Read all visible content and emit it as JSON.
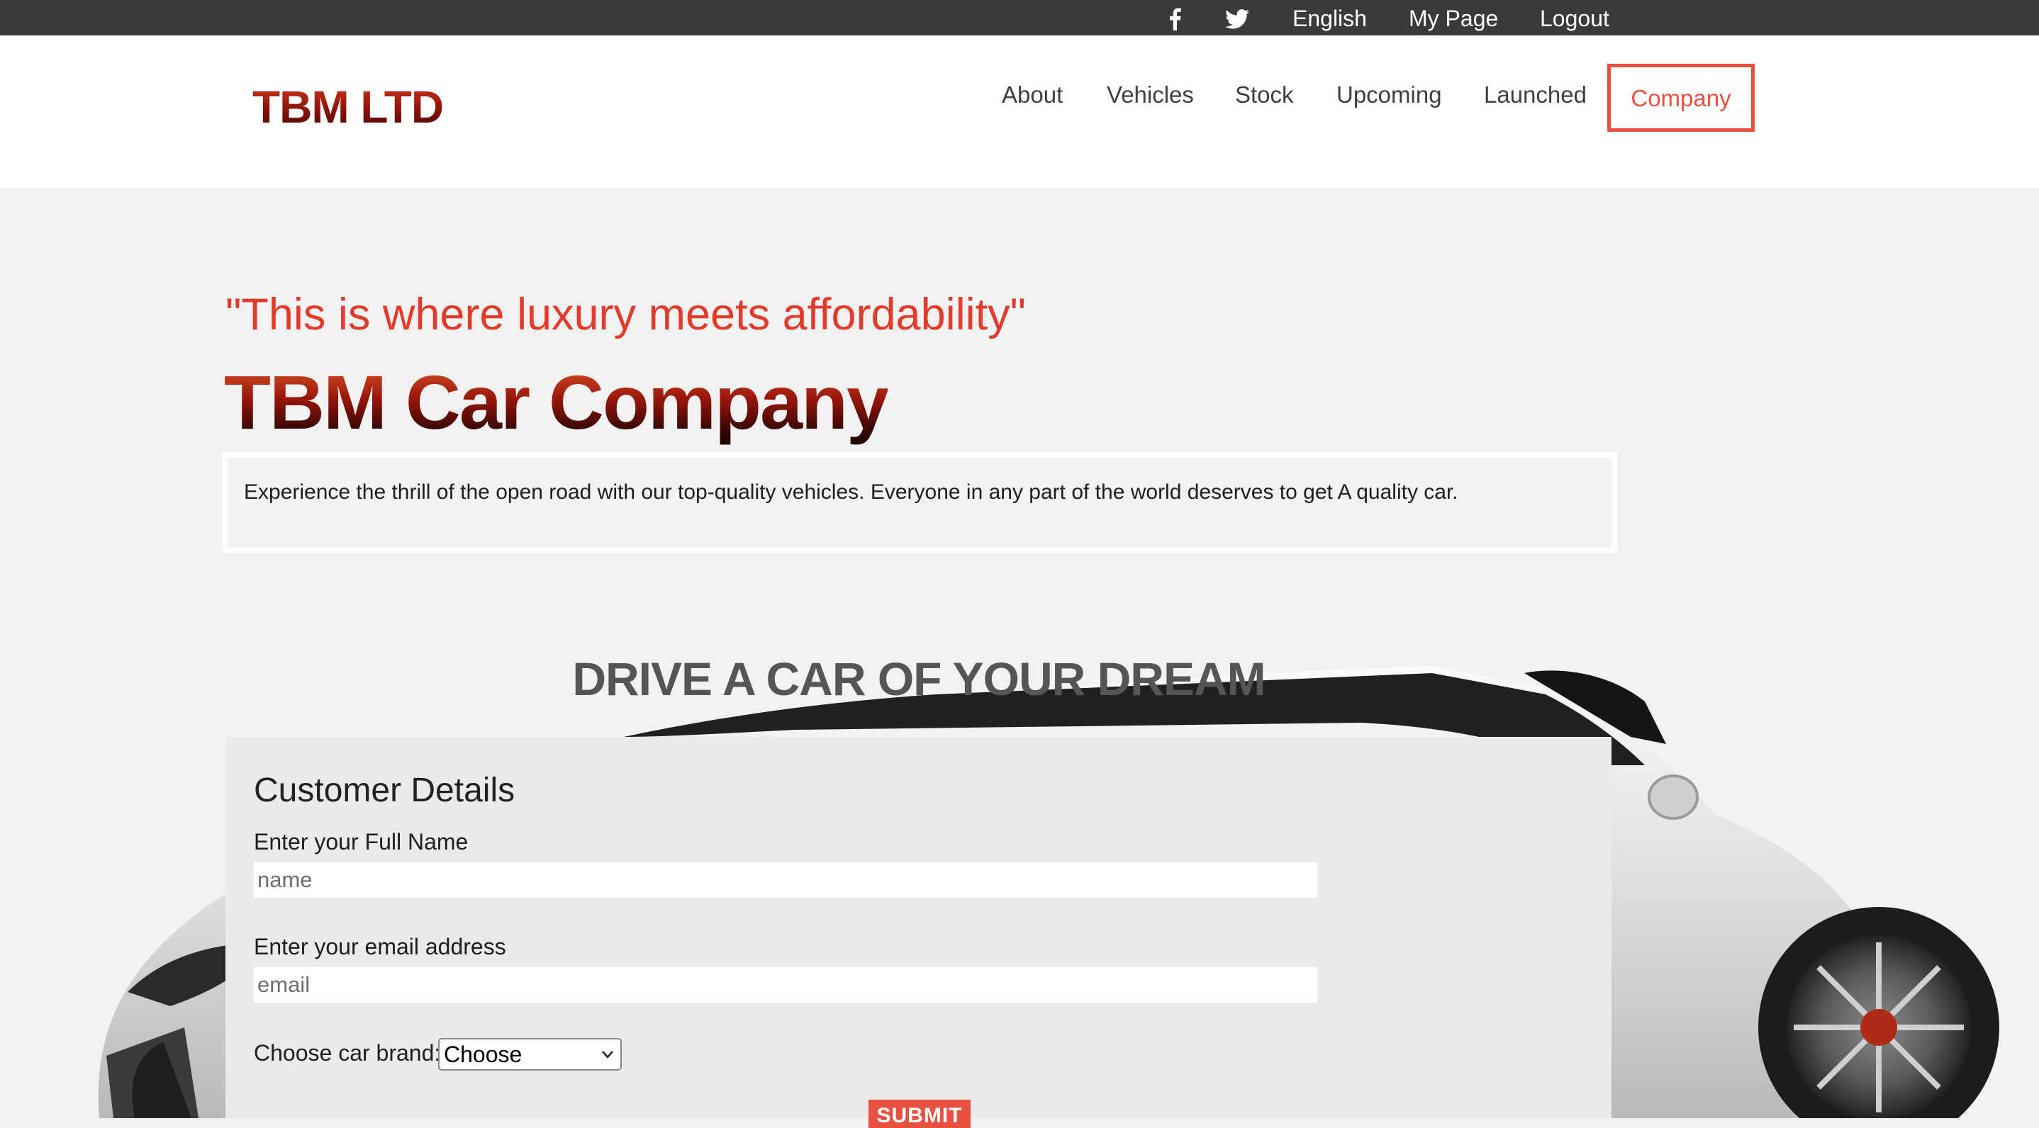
{
  "topbar": {
    "facebook_icon": "facebook-icon",
    "twitter_icon": "twitter-icon",
    "language": "English",
    "my_page": "My Page",
    "logout": "Logout"
  },
  "header": {
    "logo": "TBM LTD",
    "nav": {
      "about": "About",
      "vehicles": "Vehicles",
      "stock": "Stock",
      "upcoming": "Upcoming",
      "launched": "Launched",
      "company": "Company"
    }
  },
  "hero": {
    "tagline": "\"This is where luxury meets affordability\"",
    "title": "TBM Car Company",
    "description": "Experience the thrill of the open road with our top-quality vehicles. Everyone in any part of the world deserves to get A quality car."
  },
  "dream": {
    "heading": "DRIVE A CAR OF YOUR DREAM"
  },
  "form": {
    "title": "Customer Details",
    "name_label": "Enter your Full Name",
    "name_placeholder": "name",
    "email_label": "Enter your email address",
    "email_placeholder": "email",
    "brand_label": "Choose car brand:",
    "brand_selected": "Choose",
    "submit_label": "SUBMIT"
  },
  "colors": {
    "accent": "#e8503f",
    "topbar_bg": "#3a3a3a",
    "page_bg": "#f2f2f2",
    "form_bg": "#ebebeb",
    "logo_red": "#a8190f"
  }
}
